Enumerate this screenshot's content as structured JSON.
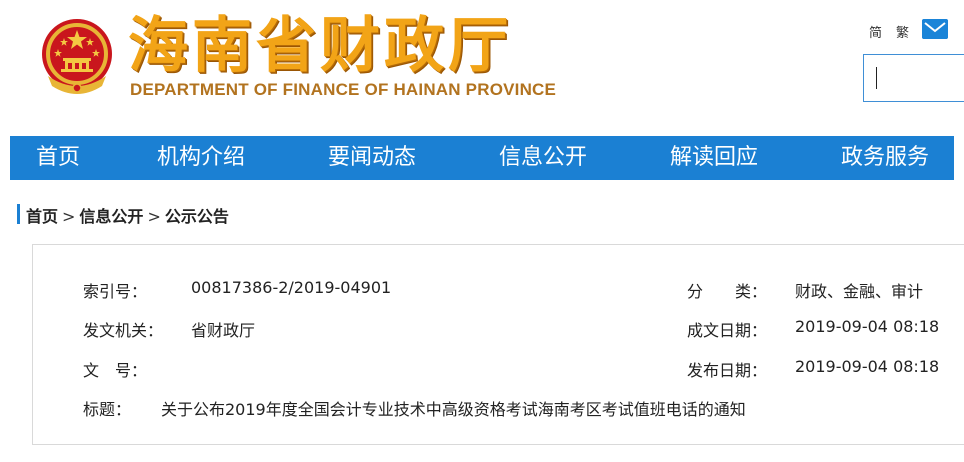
{
  "header": {
    "title_cn": "海南省财政厅",
    "title_en": "DEPARTMENT OF FINANCE OF HAINAN PROVINCE",
    "lang_simplified": "简",
    "lang_traditional": "繁",
    "mail_icon": "mail-icon",
    "search": {
      "value": ""
    }
  },
  "nav": {
    "items": [
      {
        "label": "首页"
      },
      {
        "label": "机构介绍"
      },
      {
        "label": "要闻动态"
      },
      {
        "label": "信息公开"
      },
      {
        "label": "解读回应"
      },
      {
        "label": "政务服务"
      }
    ]
  },
  "breadcrumb": {
    "items": [
      "首页",
      "信息公开",
      "公示公告"
    ],
    "separator": ">"
  },
  "info": {
    "index_label": "索引号：",
    "index_value": "00817386-2/2019-04901",
    "category_label": "分　　类：",
    "category_value": "财政、金融、审计",
    "issuer_label": "发文机关：",
    "issuer_value": "省财政厅",
    "created_label": "成文日期：",
    "created_value": "2019-09-04 08:18",
    "docno_label": "文　号：",
    "docno_value": "",
    "published_label": "发布日期：",
    "published_value": "2019-09-04 08:18",
    "subject_label": "标题：",
    "subject_value": "关于公布2019年度全国会计专业技术中高级资格考试海南考区考试值班电话的通知"
  },
  "colors": {
    "nav_bg": "#1b80d3",
    "title_orange": "#f2a417",
    "title_en_brown": "#b2731f"
  }
}
